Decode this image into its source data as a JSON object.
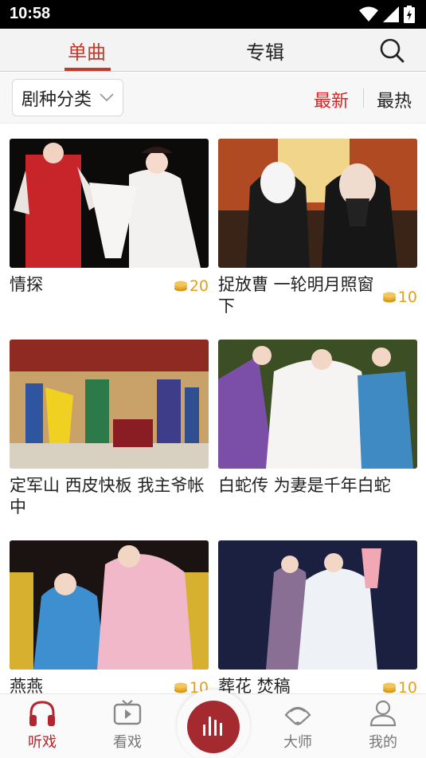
{
  "status_bar": {
    "time": "10:58"
  },
  "top_tabs": {
    "single": "单曲",
    "album": "专辑"
  },
  "filter": {
    "category": "剧种分类",
    "sort_latest": "最新",
    "sort_hot": "最热"
  },
  "colors": {
    "accent": "#c0392b",
    "brand_red": "#a52a2f",
    "coin": "#e0a020"
  },
  "items": [
    {
      "title": "情探",
      "price": "20"
    },
    {
      "title": "捉放曹 一轮明月照窗下",
      "price": "10"
    },
    {
      "title": "定军山 西皮快板 我主爷帐中",
      "price": ""
    },
    {
      "title": "白蛇传 为妻是千年白蛇",
      "price": ""
    },
    {
      "title": "燕燕",
      "price": "10"
    },
    {
      "title": "葬花 焚稿",
      "price": "10"
    }
  ],
  "bottom_nav": {
    "listen": "听戏",
    "watch": "看戏",
    "masters": "大师",
    "mine": "我的"
  },
  "icons": [
    "wifi-icon",
    "signal-icon",
    "battery-icon",
    "search-icon",
    "chevron-down-icon",
    "coin-icon",
    "headphones-icon",
    "tv-icon",
    "equalizer-icon",
    "fan-icon",
    "user-icon"
  ]
}
